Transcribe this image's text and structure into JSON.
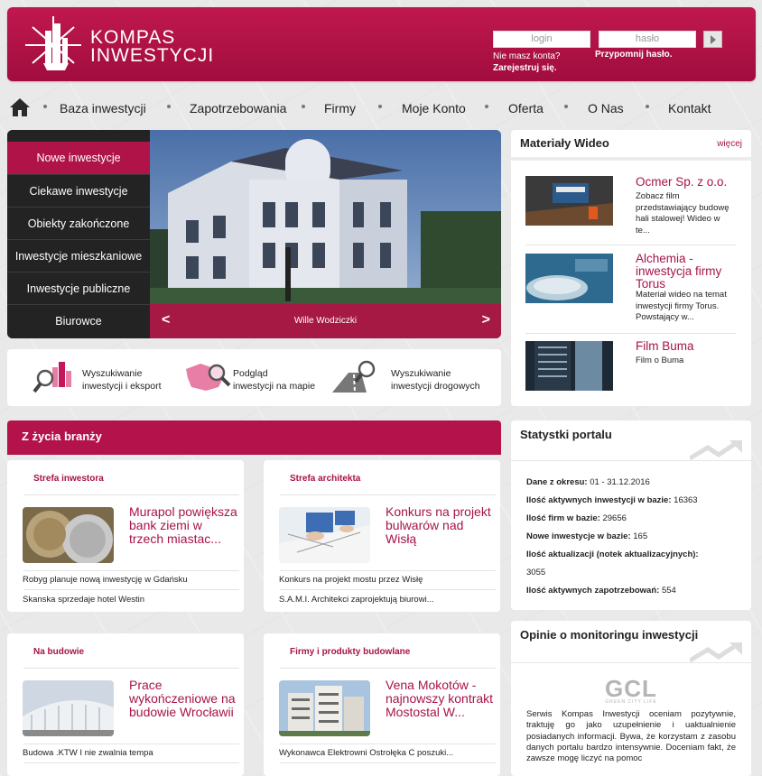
{
  "header": {
    "logo_line1": "KOMPAS",
    "logo_line2": "INWESTYCJI",
    "login_placeholder": "login",
    "password_placeholder": "hasło",
    "no_account": "Nie masz konta?",
    "register": "Zarejestruj się.",
    "remind_password": "Przypomnij hasło."
  },
  "nav": {
    "items": [
      "Baza inwestycji",
      "Zapotrzebowania",
      "Firmy",
      "Moje Konto",
      "Oferta",
      "O Nas",
      "Kontakt"
    ]
  },
  "slider": {
    "menu": [
      "Nowe inwestycje",
      "Ciekawe inwestycje",
      "Obiekty zakończone",
      "Inwestycje mieszkaniowe",
      "Inwestycje publiczne",
      "Biurowce"
    ],
    "active_index": 0,
    "caption": "Wille Wodziczki",
    "prev": "<",
    "next": ">"
  },
  "tools": [
    {
      "line1": "Wyszukiwanie",
      "line2": "inwestycji i eksport"
    },
    {
      "line1": "Podgląd",
      "line2": "inwestycji na mapie"
    },
    {
      "line1": "Wyszukiwanie",
      "line2": "inwestycji drogowych"
    }
  ],
  "industry": {
    "title": "Z życia branży",
    "cards": [
      {
        "category": "Strefa inwestora",
        "headline": "Murapol powiększa bank ziemi w trzech miastac...",
        "links": [
          "Robyg planuje nową inwestycję w Gdańsku",
          "Skanska sprzedaje hotel Westin"
        ]
      },
      {
        "category": "Strefa architekta",
        "headline": "Konkurs na projekt bulwarów nad Wisłą",
        "links": [
          "Konkurs na projekt mostu przez Wisłę",
          "S.A.M.I. Architekci zaprojektują biurowi..."
        ]
      },
      {
        "category": "Na budowie",
        "headline": "Prace wykończeniowe na budowie Wrocławii",
        "links": [
          "Budowa .KTW I nie zwalnia tempa"
        ]
      },
      {
        "category": "Firmy i produkty budowlane",
        "headline": "Vena Mokotów - najnowszy kontrakt Mostostal W...",
        "links": [
          "Wykonawca Elektrowni Ostrołęka C poszuki..."
        ]
      }
    ]
  },
  "videos": {
    "title": "Materiały Wideo",
    "more": "więcej",
    "items": [
      {
        "title": "Ocmer Sp. z o.o.",
        "desc": "Zobacz film przedstawiający budowę hali stalowej! Wideo w te..."
      },
      {
        "title": "Alchemia - inwestycja firmy Torus",
        "desc": "Materiał wideo na temat inwestycji firmy Torus. Powstający w..."
      },
      {
        "title": "Film Buma",
        "desc": "Film o Buma"
      }
    ]
  },
  "stats": {
    "title": "Statystki portalu",
    "rows": [
      {
        "label": "Dane z okresu:",
        "value": "01 - 31.12.2016"
      },
      {
        "label": "Ilość aktywnych inwestycji w bazie:",
        "value": "16363"
      },
      {
        "label": "Ilość firm w bazie:",
        "value": "29656"
      },
      {
        "label": "Nowe inwestycje w bazie:",
        "value": "165"
      },
      {
        "label": "Ilość aktualizacji (notek aktualizacyjnych):",
        "value": ""
      },
      {
        "label": "",
        "value": "3055"
      },
      {
        "label": "Ilość aktywnych zapotrzebowań:",
        "value": "554"
      }
    ]
  },
  "opinions": {
    "title": "Opinie o monitoringu inwestycji",
    "logo": "GCL",
    "logo_sub": "GREEN CITY LIFE",
    "text": "Serwis Kompas Inwestycji oceniam pozytywnie, traktuję go jako uzupełnienie i uaktualnienie posiadanych informacji. Bywa, że korzystam z zasobu danych portalu bardzo intensywnie. Doceniam fakt, że zawsze mogę liczyć na pomoc"
  },
  "colors": {
    "brand": "#b3124a",
    "accent_text": "#a7134a"
  }
}
